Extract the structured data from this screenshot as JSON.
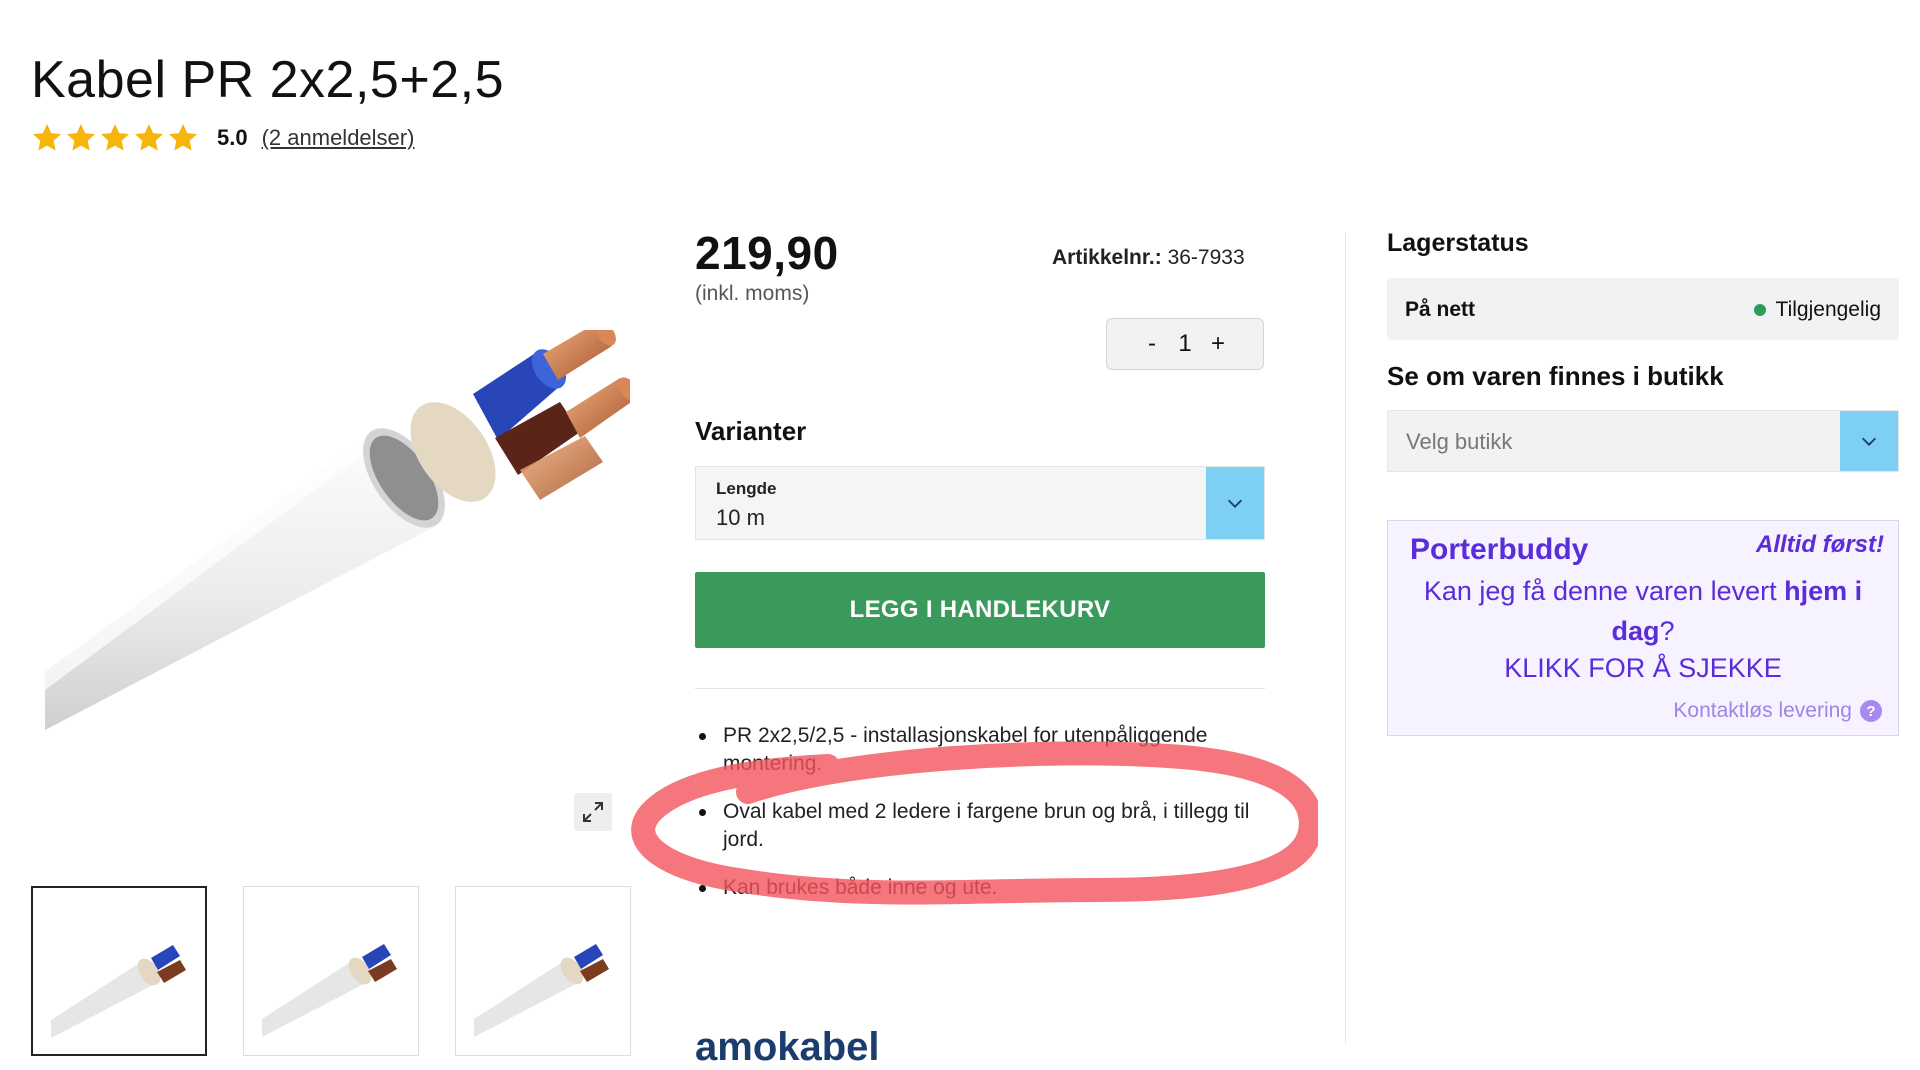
{
  "product": {
    "title": "Kabel PR 2x2,5+2,5",
    "rating_score": "5.0",
    "rating_stars": 5,
    "reviews_link": "(2 anmeldelser)",
    "price": "219,90",
    "vat_note": "(inkl. moms)",
    "article_label": "Artikkelnr.:",
    "article_number": "36-7933"
  },
  "quantity": {
    "minus": "-",
    "value": "1",
    "plus": "+"
  },
  "variants": {
    "heading": "Varianter",
    "length_label": "Lengde",
    "length_value": "10 m"
  },
  "cart_button": "LEGG I HANDLEKURV",
  "features": [
    "PR 2x2,5/2,5 - installasjonskabel for utenpåliggende montering.",
    "Oval kabel med 2 ledere i fargene brun og brå, i tillegg til jord.",
    "Kan brukes både inne og ute."
  ],
  "brand_text": "amokabel",
  "stock": {
    "heading": "Lagerstatus",
    "online_label": "På nett",
    "online_status": "Tilgjengelig",
    "status_color": "#2e9a5c"
  },
  "store": {
    "heading": "Se om varen finnes i butikk",
    "placeholder": "Velg butikk"
  },
  "porterbuddy": {
    "logo": "Porterbuddy",
    "tagline": "Alltid først!",
    "question_pre": "Kan jeg få denne varen levert ",
    "question_bold": "hjem i dag",
    "question_post": "?",
    "cta": "KLIKK FOR Å SJEKKE",
    "contactless": "Kontaktløs levering",
    "help": "?"
  },
  "colors": {
    "accent_green": "#3a9a5c",
    "dropdown_blue": "#7dd0f3",
    "porter_purple": "#5b2cd9",
    "annotation_red": "#f2545b"
  },
  "icons": {
    "star": "star-icon",
    "expand": "expand-icon",
    "chevron": "chevron-down-icon",
    "help": "help-icon"
  }
}
